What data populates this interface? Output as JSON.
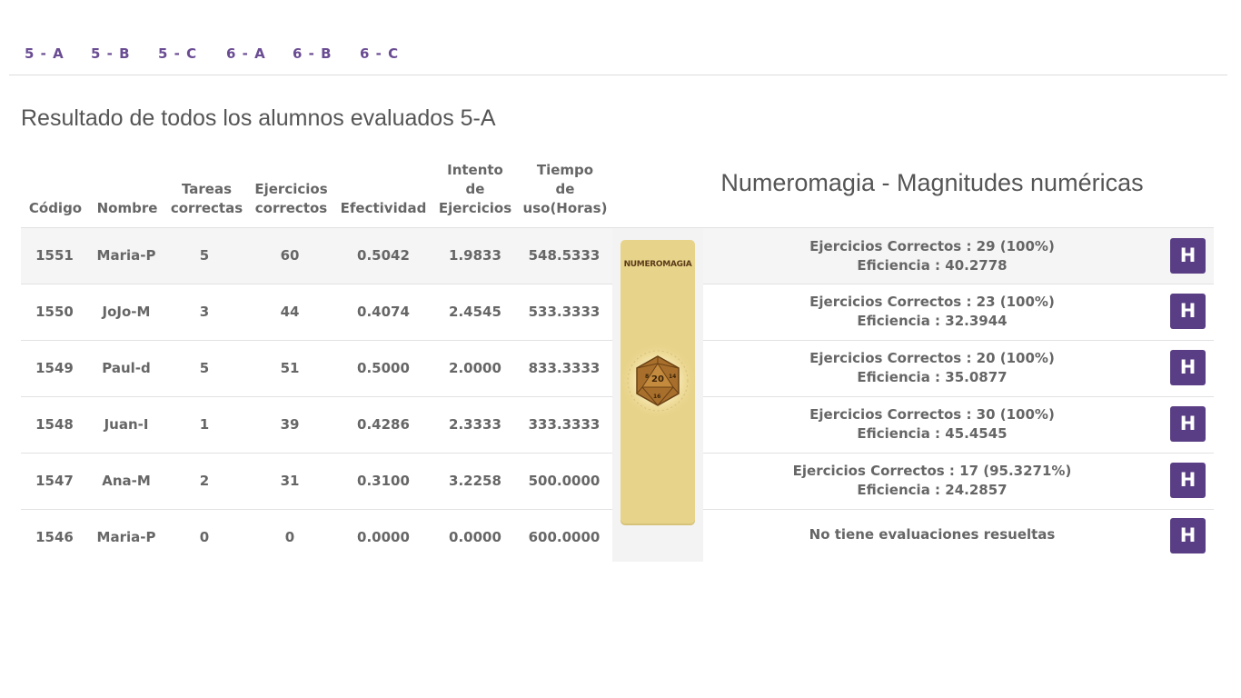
{
  "tabs": [
    "5 - A",
    "5 - B",
    "5 - C",
    "6 - A",
    "6 - B",
    "6 - C"
  ],
  "page_title": "Resultado de todos los alumnos evaluados 5-A",
  "table": {
    "headers": {
      "codigo": [
        "Código"
      ],
      "nombre": [
        "Nombre"
      ],
      "tareas": [
        "Tareas",
        "correctas"
      ],
      "ejercicios": [
        "Ejercicios",
        "correctos"
      ],
      "efectividad": [
        "Efectividad"
      ],
      "intento": [
        "Intento",
        "de",
        "Ejercicios"
      ],
      "tiempo": [
        "Tiempo",
        "de",
        "uso(Horas)"
      ]
    },
    "rows": [
      {
        "codigo": "1551",
        "nombre": "Maria-P",
        "tareas": "5",
        "ejercicios": "60",
        "efectividad": "0.5042",
        "intento": "1.9833",
        "tiempo": "548.5333"
      },
      {
        "codigo": "1550",
        "nombre": "JoJo-M",
        "tareas": "3",
        "ejercicios": "44",
        "efectividad": "0.4074",
        "intento": "2.4545",
        "tiempo": "533.3333"
      },
      {
        "codigo": "1549",
        "nombre": "Paul-d",
        "tareas": "5",
        "ejercicios": "51",
        "efectividad": "0.5000",
        "intento": "2.0000",
        "tiempo": "833.3333"
      },
      {
        "codigo": "1548",
        "nombre": "Juan-I",
        "tareas": "1",
        "ejercicios": "39",
        "efectividad": "0.4286",
        "intento": "2.3333",
        "tiempo": "333.3333"
      },
      {
        "codigo": "1547",
        "nombre": "Ana-M",
        "tareas": "2",
        "ejercicios": "31",
        "efectividad": "0.3100",
        "intento": "3.2258",
        "tiempo": "500.0000"
      },
      {
        "codigo": "1546",
        "nombre": "Maria-P",
        "tareas": "0",
        "ejercicios": "0",
        "efectividad": "0.0000",
        "intento": "0.0000",
        "tiempo": "600.0000"
      }
    ]
  },
  "game": {
    "title": "Numeromagia - Magnitudes numéricas",
    "logo_text": "NUMEROMAGIA",
    "results": [
      {
        "line1": "Ejercicios Correctos : 29 (100%)",
        "line2": "Eficiencia : 40.2778"
      },
      {
        "line1": "Ejercicios Correctos : 23 (100%)",
        "line2": "Eficiencia : 32.3944"
      },
      {
        "line1": "Ejercicios Correctos : 20 (100%)",
        "line2": "Eficiencia : 35.0877"
      },
      {
        "line1": "Ejercicios Correctos : 30 (100%)",
        "line2": "Eficiencia : 45.4545"
      },
      {
        "line1": "Ejercicios Correctos : 17 (95.3271%)",
        "line2": "Eficiencia : 24.2857"
      },
      {
        "line1": "No tiene evaluaciones resueltas",
        "line2": ""
      }
    ],
    "history_button_label": "H"
  },
  "colors": {
    "tab_text": "#6a4c93",
    "history_button": "#5a3e85",
    "game_card": "#e8d38a",
    "row_shaded": "#f5f5f5"
  },
  "icons": {
    "game_image": "d20-dice-icon"
  }
}
